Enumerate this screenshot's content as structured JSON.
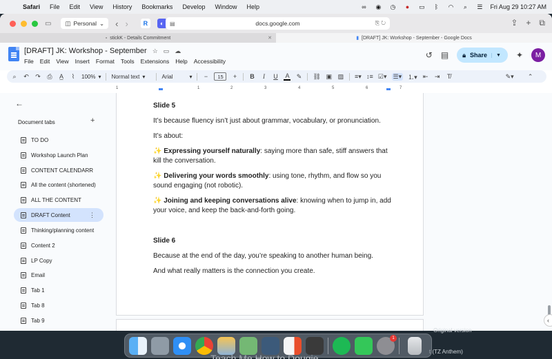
{
  "menubar": {
    "app": "Safari",
    "items": [
      "File",
      "Edit",
      "View",
      "History",
      "Bookmarks",
      "Develop",
      "Window",
      "Help"
    ],
    "datetime": "Fri Aug 29  10:27 AM"
  },
  "browser": {
    "profile": "Personal",
    "url": "docs.google.com",
    "tabs": [
      {
        "title": "stickK - Details Commitment",
        "active": false
      },
      {
        "title": "[DRAFT] JK: Workshop - September - Google Docs",
        "active": true
      }
    ]
  },
  "doc": {
    "title": "[DRAFT] JK: Workshop - September",
    "menus": [
      "File",
      "Edit",
      "View",
      "Insert",
      "Format",
      "Tools",
      "Extensions",
      "Help",
      "Accessibility"
    ],
    "share_label": "Share",
    "avatar_letter": "M"
  },
  "toolbar": {
    "zoom": "100%",
    "style": "Normal text",
    "font": "Arial",
    "font_size": "15"
  },
  "ruler": {
    "ticks": [
      "1",
      "1",
      "2",
      "3",
      "4",
      "5",
      "6",
      "7"
    ]
  },
  "left_panel": {
    "heading": "Document tabs",
    "items": [
      {
        "label": "TO DO",
        "active": false
      },
      {
        "label": "Workshop Launch Plan",
        "active": false
      },
      {
        "label": "CONTENT CALENDARR",
        "active": false
      },
      {
        "label": "All the content (shortened)",
        "active": false
      },
      {
        "label": "ALL THE CONTENT",
        "active": false
      },
      {
        "label": "DRAFT Content",
        "active": true
      },
      {
        "label": "Thinking/planning content",
        "active": false
      },
      {
        "label": "Content 2",
        "active": false
      },
      {
        "label": "LP Copy",
        "active": false
      },
      {
        "label": "Email",
        "active": false
      },
      {
        "label": "Tab 1",
        "active": false
      },
      {
        "label": "Tab 8",
        "active": false
      },
      {
        "label": "Tab 9",
        "active": false
      }
    ]
  },
  "content": {
    "slide5_heading": "Slide 5",
    "p1": "It’s because fluency isn’t just about grammar, vocabulary, or pronunciation.",
    "p2": "It’s about:",
    "b1_spark": "✨",
    "b1_bold": "Expressing yourself naturally",
    "b1_rest": ": saying more than safe, stiff answers that kill the conversation.",
    "b2_spark": "✨",
    "b2_bold": "Delivering your words smoothly",
    "b2_rest": ": using tone, rhythm, and flow so you sound engaging (not robotic).",
    "b3_spark": "✨",
    "b3_bold": "Joining and keeping conversations alive",
    "b3_rest": ": knowing when to jump in, add your voice, and keep the back-and-forth going.",
    "slide6_heading": "Slide 6",
    "p3": "Because at the end of the day, you’re speaking to another human being.",
    "p4": "And what really matters is the connection you create."
  },
  "desktop": {
    "bg_text_1": "Original version",
    "bg_text_2": "t (TZ Anthem)",
    "bg_text_3": "Teach Me How to Dougie",
    "dock_badge": "1"
  },
  "colors": {
    "accent": "#4285f4",
    "share_bg": "#c2e7ff",
    "active_tab_bg": "#d3e3fd",
    "avatar": "#7b1fa2"
  }
}
